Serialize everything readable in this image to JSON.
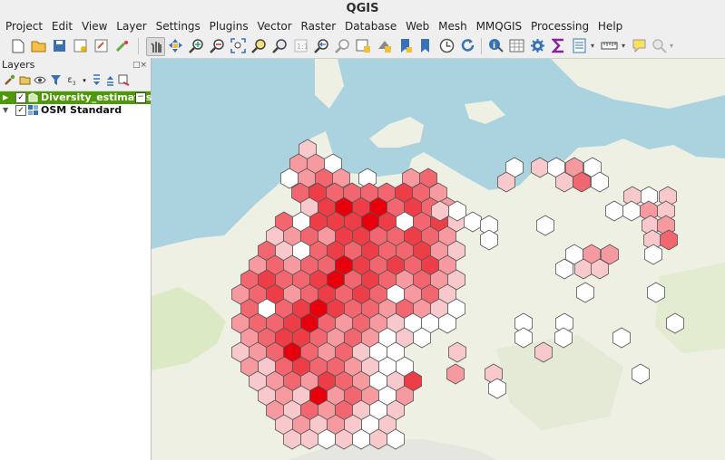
{
  "app": {
    "title": "QGIS"
  },
  "menu": [
    "Project",
    "Edit",
    "View",
    "Layer",
    "Settings",
    "Plugins",
    "Vector",
    "Raster",
    "Database",
    "Web",
    "Mesh",
    "MMQGIS",
    "Processing",
    "Help"
  ],
  "layers_panel": {
    "title": "Layers",
    "layers": [
      {
        "name": "Diversity_estimates",
        "checked": true,
        "selected": true,
        "icon": "polygon-layer-icon"
      },
      {
        "name": "OSM Standard",
        "checked": true,
        "selected": false,
        "icon": "raster-tile-layer-icon"
      }
    ]
  },
  "colors": {
    "hex_white": "#ffffff",
    "hex_light": "#f8c9cc",
    "hex_medium": "#f69aa0",
    "hex_strong": "#f1666f",
    "hex_dark": "#ed3d47",
    "hex_max": "#e7000c",
    "selected_layer": "#4e9a06",
    "sea": "#aad3df",
    "land": "#eef0e4"
  }
}
